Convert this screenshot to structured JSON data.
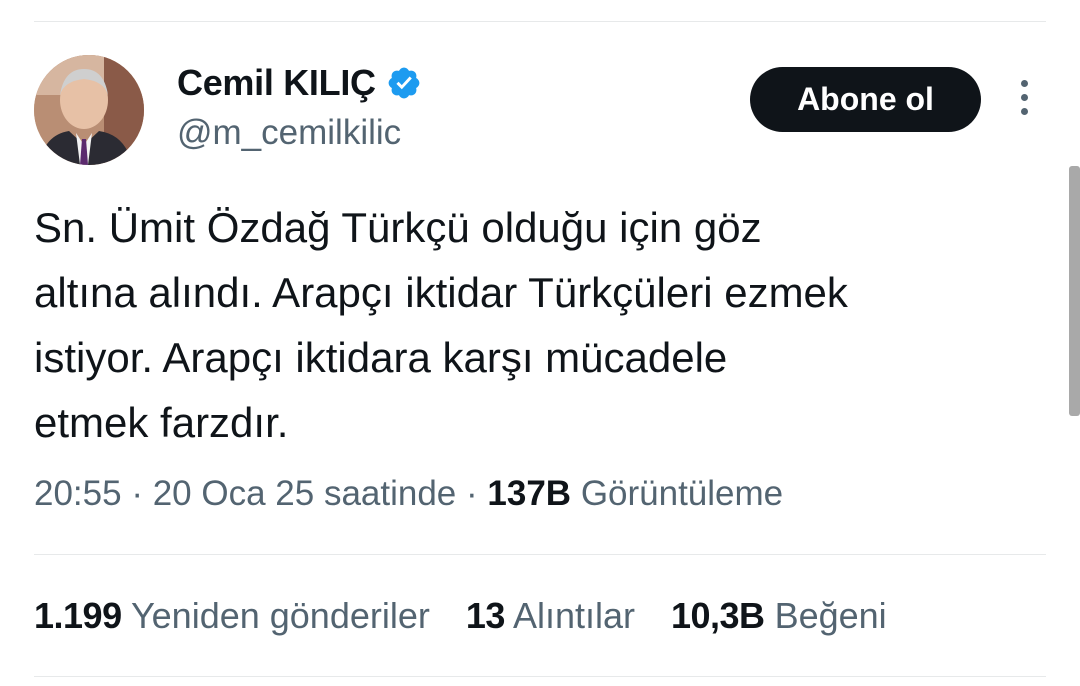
{
  "author": {
    "name": "Cemil KILIÇ",
    "handle": "@m_cemilkilic",
    "verified_color": "#1d9bf0"
  },
  "follow_button": {
    "label": "Abone ol"
  },
  "more_icon": "more-vertical-icon",
  "tweet": {
    "text": "Sn. Ümit Özdağ Türkçü olduğu için göz\naltına alındı. Arapçı iktidar Türkçüleri ezmek\nistiyor. Arapçı iktidara karşı mücadele\netmek farzdır.",
    "time": "20:55",
    "date_text": "20 Oca 25 saatinde",
    "separator": "·",
    "views_count": "137B",
    "views_label": "Görüntüleme"
  },
  "stats": {
    "retweets_count": "1.199",
    "retweets_label": "Yeniden gönderiler",
    "quotes_count": "13",
    "quotes_label": "Alıntılar",
    "likes_count": "10,3B",
    "likes_label": "Beğeni"
  },
  "colors": {
    "text": "#0f1419",
    "secondary": "#536471",
    "divider": "#e7e9ea",
    "button": "#0f1419"
  }
}
